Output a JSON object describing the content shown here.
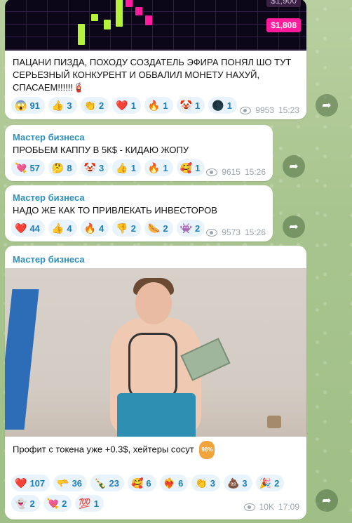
{
  "messages": [
    {
      "author": "",
      "text": "ПАЦАНИ ПИЗДА, ПОХОДУ СОЗДАТЕЛЬ ЭФИРА ПОНЯЛ ШО ТУТ СЕРЬЕЗНЫЙ КОНКУРЕНТ И ОБВАЛИЛ МОНЕТУ НАХУЙ, СПАСАЕМ!!!!!!🧯",
      "image_prices": [
        "$1,900",
        "$1,808"
      ],
      "reactions": [
        [
          "😱",
          "91"
        ],
        [
          "👍",
          "3"
        ],
        [
          "👏",
          "2"
        ],
        [
          "❤️",
          "1"
        ],
        [
          "🔥",
          "1"
        ],
        [
          "🤡",
          "1"
        ],
        [
          "🌑",
          "1"
        ]
      ],
      "views": "9953",
      "time": "15:23"
    },
    {
      "author": "Мастер бизнеса",
      "text": "ПРОБЬЕМ КАППУ В 5К$ - КИДАЮ ЖОПУ",
      "reactions": [
        [
          "💘",
          "57"
        ],
        [
          "🤔",
          "8"
        ],
        [
          "🤡",
          "3"
        ],
        [
          "👍",
          "1"
        ],
        [
          "🔥",
          "1"
        ],
        [
          "🥰",
          "1"
        ]
      ],
      "views": "9615",
      "time": "15:26"
    },
    {
      "author": "Мастер бизнеса",
      "text": "НАДО ЖЕ КАК ТО ПРИВЛЕКАТЬ ИНВЕСТОРОВ",
      "reactions": [
        [
          "❤️",
          "44"
        ],
        [
          "👍",
          "4"
        ],
        [
          "🔥",
          "4"
        ],
        [
          "👎",
          "2"
        ],
        [
          "🌭",
          "2"
        ],
        [
          "👾",
          "2"
        ]
      ],
      "views": "9573",
      "time": "15:26"
    },
    {
      "author": "Мастер бизнеса",
      "text": "Профит с токена уже +0.3$, хейтеры сосут",
      "badge": "98%",
      "reactions": [
        [
          "❤️",
          "107"
        ],
        [
          "🫳",
          "36"
        ],
        [
          "🍾",
          "23"
        ],
        [
          "🥰",
          "6"
        ],
        [
          "❤️‍🔥",
          "6"
        ],
        [
          "👏",
          "3"
        ],
        [
          "💩",
          "3"
        ],
        [
          "🎉",
          "2"
        ],
        [
          "👻",
          "2"
        ],
        [
          "💘",
          "2"
        ],
        [
          "💯",
          "1"
        ]
      ],
      "views": "10K",
      "time": "17:09"
    }
  ],
  "share_icon": "share-arrow-icon",
  "view_icon": "eye-icon"
}
